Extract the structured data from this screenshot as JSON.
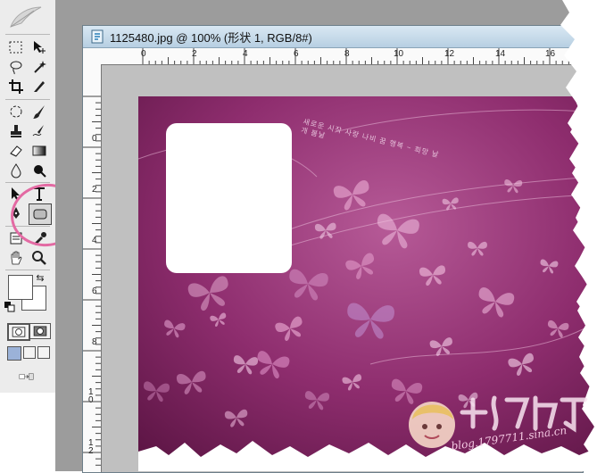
{
  "document": {
    "title": "1125480.jpg @ 100% (形状 1, RGB/8#)",
    "icon": "photoshop-document-icon"
  },
  "rulers": {
    "horizontal_labels": [
      "0",
      "2",
      "4",
      "6",
      "8",
      "10",
      "12",
      "14",
      "16"
    ],
    "vertical_labels": [
      "0",
      "2",
      "4",
      "6",
      "8",
      "10",
      "12"
    ]
  },
  "artwork": {
    "scribble_text": "새로운 시작 사랑 나비 꿈 행복 ~ 희망 날개 봄날"
  },
  "toolbox": {
    "tools": [
      "rectangular-marquee-icon",
      "move-icon",
      "lasso-icon",
      "magic-wand-icon",
      "crop-icon",
      "slice-icon",
      "healing-brush-icon",
      "brush-icon",
      "clone-stamp-icon",
      "history-brush-icon",
      "eraser-icon",
      "gradient-icon",
      "blur-icon",
      "dodge-icon",
      "path-selection-icon",
      "type-icon",
      "pen-icon",
      "rounded-rectangle-icon",
      "notes-icon",
      "eyedropper-icon",
      "hand-icon",
      "zoom-icon"
    ],
    "foreground_color": "#ffffff",
    "background_color": "#ffffff"
  },
  "colors": {
    "annotation_ring": "#e36aa3",
    "artwork_base": "#8e2d6e",
    "workspace_gray": "#9c9c9c"
  }
}
